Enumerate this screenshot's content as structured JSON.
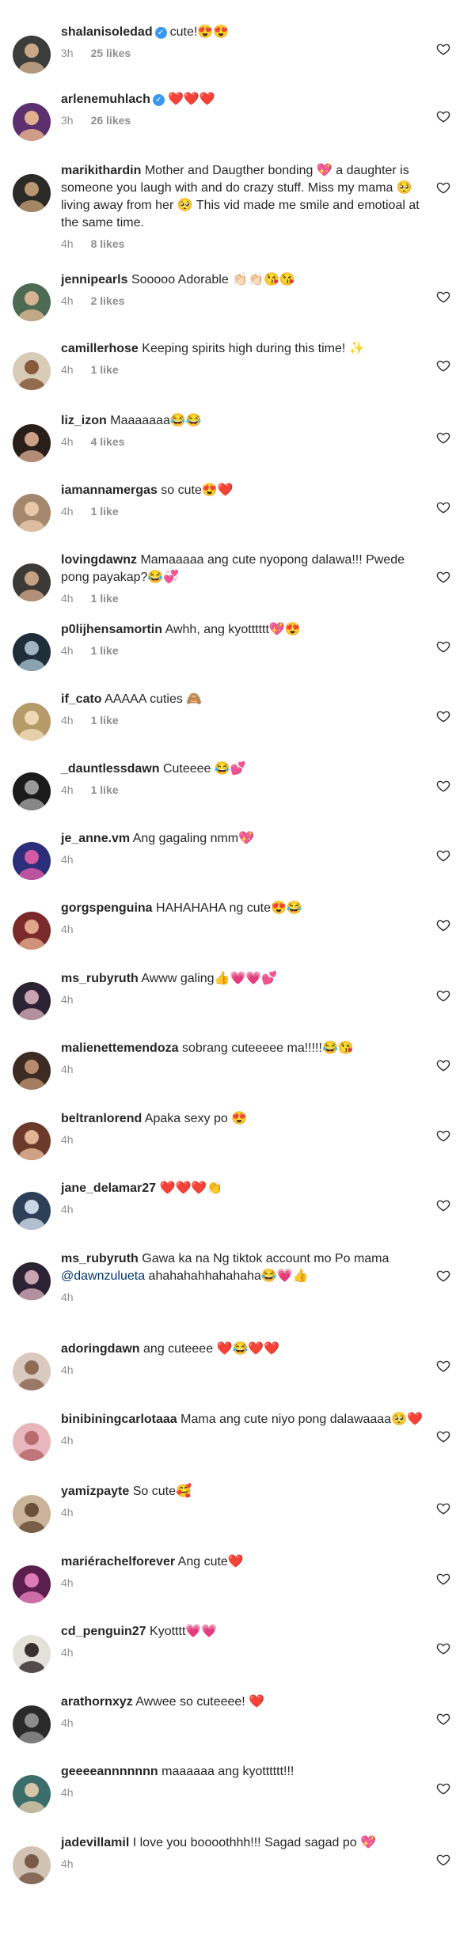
{
  "comments": [
    {
      "user": "shalanisoledad",
      "verified": true,
      "text": "cute!😍😍",
      "time": "3h",
      "likes": "25 likes",
      "avatar_colors": [
        "#3a3d3a",
        "#c9a88a"
      ]
    },
    {
      "user": "arlenemuhlach",
      "verified": true,
      "text": "❤️❤️❤️",
      "time": "3h",
      "likes": "26 likes",
      "avatar_colors": [
        "#5c2f6e",
        "#e0b08d"
      ]
    },
    {
      "user": "marikithardin",
      "verified": false,
      "text": "Mother and Daugther bonding 💖 a daughter is someone you laugh with and do crazy stuff. Miss my mama 🥺 living away from her 🥺 This vid made me smile and emotioal at the same time.",
      "time": "4h",
      "likes": "8 likes",
      "avatar_colors": [
        "#2c2a26",
        "#b8976f"
      ]
    },
    {
      "user": "jennipearls",
      "verified": false,
      "text": "Sooooo Adorable 👏🏻👏🏻😘😘",
      "time": "4h",
      "likes": "2 likes",
      "avatar_colors": [
        "#4d6b52",
        "#d6b391"
      ]
    },
    {
      "user": "camillerhose",
      "verified": false,
      "text": "Keeping spirits high during this time! ✨",
      "time": "4h",
      "likes": "1 like",
      "avatar_colors": [
        "#d8cbb8",
        "#8a5a3c"
      ]
    },
    {
      "user": "liz_izon",
      "verified": false,
      "text": "Maaaaaaa😂😂",
      "time": "4h",
      "likes": "4 likes",
      "avatar_colors": [
        "#2a1e1a",
        "#caa087"
      ]
    },
    {
      "user": "iamannamergas",
      "verified": false,
      "text": "so cute😍❤️",
      "time": "4h",
      "likes": "1 like",
      "avatar_colors": [
        "#a3886e",
        "#e7c7a8"
      ]
    },
    {
      "user": "lovingdawnz",
      "verified": false,
      "text": "Mamaaaaa ang cute nyopong dalawa!!! Pwede pong payakap?😂💞",
      "time": "4h",
      "likes": "1 like",
      "avatar_colors": [
        "#3d3a36",
        "#c4a183"
      ]
    },
    {
      "user": "p0lijhensamortin",
      "verified": false,
      "text": "Awhh, ang kyotttttt💖😍",
      "time": "4h",
      "likes": "1 like",
      "avatar_colors": [
        "#1f2e3a",
        "#9fb5c4"
      ]
    },
    {
      "user": "if_cato",
      "verified": false,
      "text": "AAAAA cuties 🙈",
      "time": "4h",
      "likes": "1 like",
      "avatar_colors": [
        "#b59a6a",
        "#efd9b5"
      ]
    },
    {
      "user": "_dauntlessdawn",
      "verified": false,
      "text": "Cuteeee 😂💕",
      "time": "4h",
      "likes": "1 like",
      "avatar_colors": [
        "#1b1b1b",
        "#9a9a9a"
      ]
    },
    {
      "user": "je_anne.vm",
      "verified": false,
      "text": "Ang gagaling nmm💖",
      "time": "4h",
      "likes": "",
      "avatar_colors": [
        "#2b2f7a",
        "#d65aa3"
      ]
    },
    {
      "user": "gorgspenguina",
      "verified": false,
      "text": "HAHAHAHA ng cute😍😂",
      "time": "4h",
      "likes": "",
      "avatar_colors": [
        "#7a2a2a",
        "#e0a58a"
      ]
    },
    {
      "user": "ms_rubyruth",
      "verified": false,
      "text": "Awww galing👍💗💗💕",
      "time": "4h",
      "likes": "",
      "avatar_colors": [
        "#2b2233",
        "#caa3b0"
      ]
    },
    {
      "user": "malienettemendoza",
      "verified": false,
      "text": "sobrang cuteeeee ma!!!!!😂😘",
      "time": "4h",
      "likes": "",
      "avatar_colors": [
        "#3b2b22",
        "#b78b6b"
      ]
    },
    {
      "user": "beltranlorend",
      "verified": false,
      "text": "Apaka sexy po 😍",
      "time": "4h",
      "likes": "",
      "avatar_colors": [
        "#6b3a2a",
        "#e2b496"
      ]
    },
    {
      "user": "jane_delamar27",
      "verified": false,
      "text": "❤️❤️❤️👏",
      "time": "4h",
      "likes": "",
      "avatar_colors": [
        "#2e4057",
        "#c8d6e5"
      ]
    },
    {
      "user": "ms_rubyruth",
      "verified": false,
      "text": "Gawa ka na Ng tiktok account mo Po mama",
      "mention": "@dawnzulueta",
      "text_after": " ahahahahhahahaha😂💗👍",
      "time": "4h",
      "likes": "",
      "avatar_colors": [
        "#2b2233",
        "#caa3b0"
      ]
    },
    {
      "user": "adoringdawn",
      "verified": false,
      "text": "ang cuteeee ❤️😂❤️❤️",
      "time": "4h",
      "likes": "",
      "avatar_colors": [
        "#d9c9bf",
        "#8f6a55"
      ]
    },
    {
      "user": "binibiningcarlotaaa",
      "verified": false,
      "text": "Mama ang cute niyo pong dalawaaaa🥺❤️",
      "time": "4h",
      "likes": "",
      "avatar_colors": [
        "#e8b7bd",
        "#b86a6f"
      ]
    },
    {
      "user": "yamizpayte",
      "verified": false,
      "text": "So cute🥰",
      "time": "4h",
      "likes": "",
      "avatar_colors": [
        "#c9b49a",
        "#6b4f3a"
      ]
    },
    {
      "user": "mariérachelforever",
      "verified": false,
      "text": "Ang cute❤️",
      "time": "4h",
      "likes": "",
      "avatar_colors": [
        "#5a1f4d",
        "#e07ab8"
      ]
    },
    {
      "user": "cd_penguin27",
      "verified": false,
      "text": "Kyotttt💗💗",
      "time": "4h",
      "likes": "",
      "avatar_colors": [
        "#e4e0da",
        "#3a3030"
      ]
    },
    {
      "user": "arathornxyz",
      "verified": false,
      "text": "Awwee so cuteeee! ❤️",
      "time": "4h",
      "likes": "",
      "avatar_colors": [
        "#2a2a2a",
        "#8c8c8c"
      ]
    },
    {
      "user": "geeeeannnnnnn",
      "verified": false,
      "text": "maaaaaa ang kyotttttt!!!",
      "time": "4h",
      "likes": "",
      "avatar_colors": [
        "#3b6e6a",
        "#d6c5a8"
      ]
    },
    {
      "user": "jadevillamil",
      "verified": false,
      "text": "I love you boooothhh!!! Sagad sagad po 💖",
      "time": "4h",
      "likes": "",
      "avatar_colors": [
        "#d2c2b4",
        "#7a5a48"
      ]
    }
  ],
  "colors": {
    "username": "#262626",
    "meta": "#8e8e8e",
    "verified": "#3897f0",
    "heart": "#262626"
  },
  "icons": {
    "heart": "heart-outline-icon",
    "verified": "verified-badge-icon"
  }
}
